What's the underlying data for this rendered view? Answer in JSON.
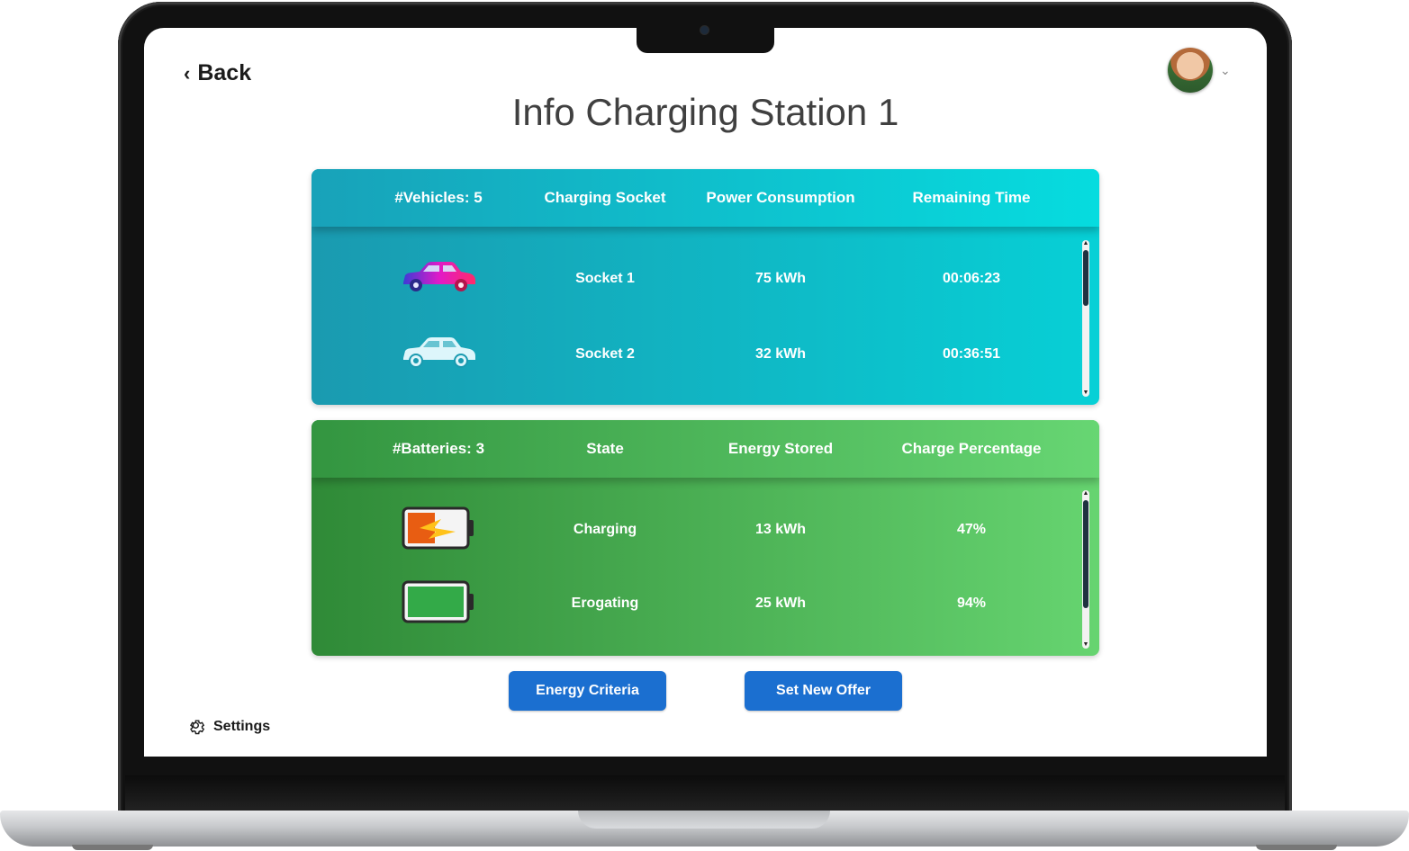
{
  "header": {
    "back_label": "Back",
    "title": "Info Charging Station 1"
  },
  "vehicles": {
    "columns": [
      "#Vehicles: 5",
      "Charging Socket",
      "Power Consumption",
      "Remaining Time"
    ],
    "rows": [
      {
        "icon": "car-pink-icon",
        "socket": "Socket 1",
        "power": "75 kWh",
        "time": "00:06:23"
      },
      {
        "icon": "car-white-icon",
        "socket": "Socket 2",
        "power": "32 kWh",
        "time": "00:36:51"
      }
    ]
  },
  "batteries": {
    "columns": [
      "#Batteries: 3",
      "State",
      "Energy Stored",
      "Charge Percentage"
    ],
    "rows": [
      {
        "icon": "battery-charging-icon",
        "state": "Charging",
        "energy": "13 kWh",
        "percentage": "47%"
      },
      {
        "icon": "battery-full-icon",
        "state": "Erogating",
        "energy": "25 kWh",
        "percentage": "94%"
      }
    ]
  },
  "actions": {
    "energy_criteria": "Energy Criteria",
    "new_offer": "Set New Offer"
  },
  "footer": {
    "settings_label": "Settings"
  },
  "colors": {
    "vehicles_panel": "#07d0d6",
    "batteries_panel": "#66d470",
    "button": "#1b6fd0"
  }
}
